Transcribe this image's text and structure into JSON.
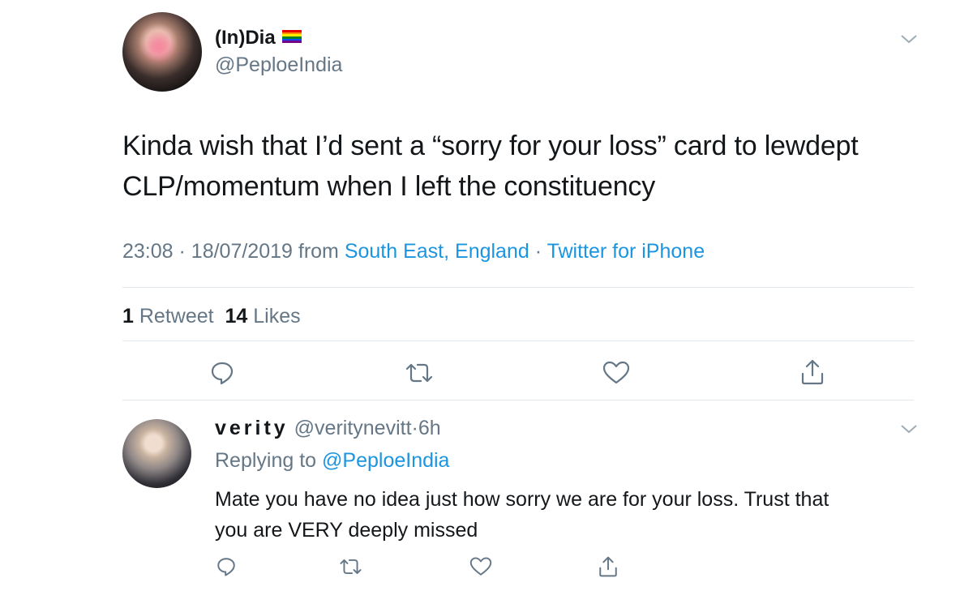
{
  "tweet": {
    "author": {
      "display_name": "(In)Dia",
      "handle": "@PeploeIndia",
      "badge": "rainbow-flag"
    },
    "text_line1": "Kinda wish that I’d sent a “sorry for your loss” card to lewdept",
    "text_line2": "CLP/momentum when I left the constituency",
    "time": "23:08",
    "sep1": "·",
    "date": "18/07/2019",
    "from_label": "from",
    "location": "South East, England",
    "sep2": "·",
    "client": "Twitter for iPhone",
    "retweet_count": "1",
    "retweet_label": "Retweet",
    "like_count": "14",
    "like_label": "Likes"
  },
  "reply": {
    "display_name": "verity",
    "handle": "@veritynevitt",
    "sep": "·",
    "age": "6h",
    "replying_label": "Replying to",
    "replying_handle": "@PeploeIndia",
    "text_line1": "Mate you have no idea just how sorry we are for your loss. Trust that",
    "text_line2": "you are VERY deeply missed"
  },
  "colors": {
    "link": "#1b95e0",
    "muted": "#657786",
    "divider": "#e1e8ed",
    "icon": "#657786"
  }
}
